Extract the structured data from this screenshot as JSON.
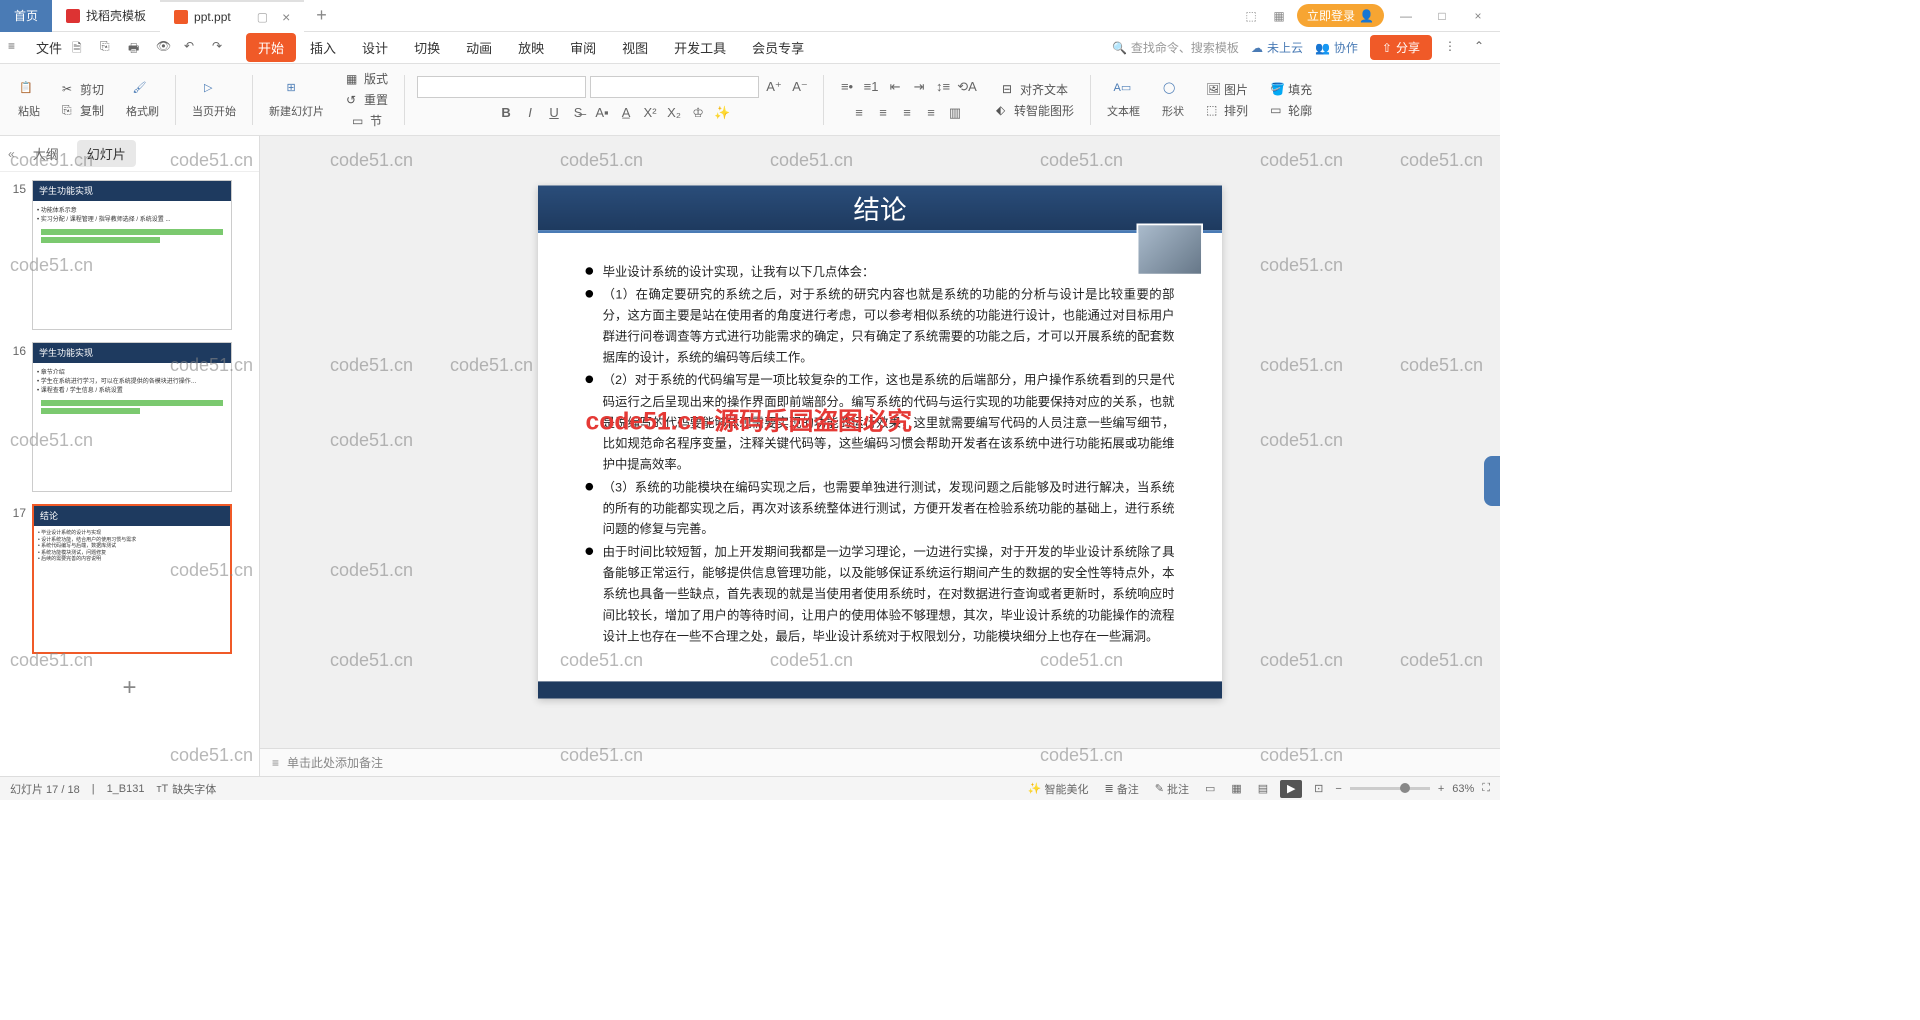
{
  "titlebar": {
    "home": "首页",
    "tab1": "找稻壳模板",
    "tab2": "ppt.ppt",
    "login": "立即登录"
  },
  "menubar": {
    "file": "文件",
    "tabs": [
      "开始",
      "插入",
      "设计",
      "切换",
      "动画",
      "放映",
      "审阅",
      "视图",
      "开发工具",
      "会员专享"
    ],
    "search": "查找命令、搜索模板",
    "cloud": "未上云",
    "coop": "协作",
    "share": "分享"
  },
  "ribbon": {
    "cut": "剪切",
    "copy": "复制",
    "paste": "粘贴",
    "format_painter": "格式刷",
    "from_current": "当页开始",
    "new_slide": "新建幻灯片",
    "layout": "版式",
    "section": "节",
    "reset": "重置",
    "align_text": "对齐文本",
    "to_smart": "转智能图形",
    "textbox": "文本框",
    "shape": "形状",
    "picture": "图片",
    "arrange": "排列",
    "fill": "填充",
    "outline": "轮廓"
  },
  "sidebar": {
    "collapse": "«",
    "tab_outline": "大纲",
    "tab_slides": "幻灯片",
    "thumbs": [
      {
        "num": "15",
        "title": "学生功能实现"
      },
      {
        "num": "16",
        "title": "学生功能实现"
      },
      {
        "num": "17",
        "title": "结论"
      }
    ]
  },
  "slide": {
    "title": "结论",
    "bullets": [
      "毕业设计系统的设计实现，让我有以下几点体会：",
      "（1）在确定要研究的系统之后，对于系统的研究内容也就是系统的功能的分析与设计是比较重要的部分，这方面主要是站在使用者的角度进行考虑，可以参考相似系统的功能进行设计，也能通过对目标用户群进行问卷调查等方式进行功能需求的确定，只有确定了系统需要的功能之后，才可以开展系统的配套数据库的设计，系统的编码等后续工作。",
      "（2）对于系统的代码编写是一项比较复杂的工作，这也是系统的后端部分，用户操作系统看到的只是代码运行之后呈现出来的操作界面即前端部分。编写系统的代码与运行实现的功能要保持对应的关系，也就是说编写的代码要能够体现需要实现的功能的运行效果，这里就需要编写代码的人员注意一些编写细节，比如规范命名程序变量，注释关键代码等，这些编码习惯会帮助开发者在该系统中进行功能拓展或功能维护中提高效率。",
      "（3）系统的功能模块在编码实现之后，也需要单独进行测试，发现问题之后能够及时进行解决，当系统的所有的功能都实现之后，再次对该系统整体进行测试，方便开发者在检验系统功能的基础上，进行系统问题的修复与完善。",
      "由于时间比较短暂，加上开发期间我都是一边学习理论，一边进行实操，对于开发的毕业设计系统除了具备能够正常运行，能够提供信息管理功能，以及能够保证系统运行期间产生的数据的安全性等特点外，本系统也具备一些缺点，首先表现的就是当使用者使用系统时，在对数据进行查询或者更新时，系统响应时间比较长，增加了用户的等待时间，让用户的使用体验不够理想，其次，毕业设计系统的功能操作的流程设计上也存在一些不合理之处，最后，毕业设计系统对于权限划分，功能模块细分上也存在一些漏洞。"
    ],
    "watermark_red": "code51.cn-源码乐园盗图必究"
  },
  "notes": {
    "placeholder": "单击此处添加备注"
  },
  "status": {
    "slide_pos": "幻灯片 17 / 18",
    "design": "1_B131",
    "missing_font": "缺失字体",
    "beautify": "智能美化",
    "notes_btn": "备注",
    "comments": "批注",
    "zoom": "63%"
  },
  "watermark": "code51.cn"
}
